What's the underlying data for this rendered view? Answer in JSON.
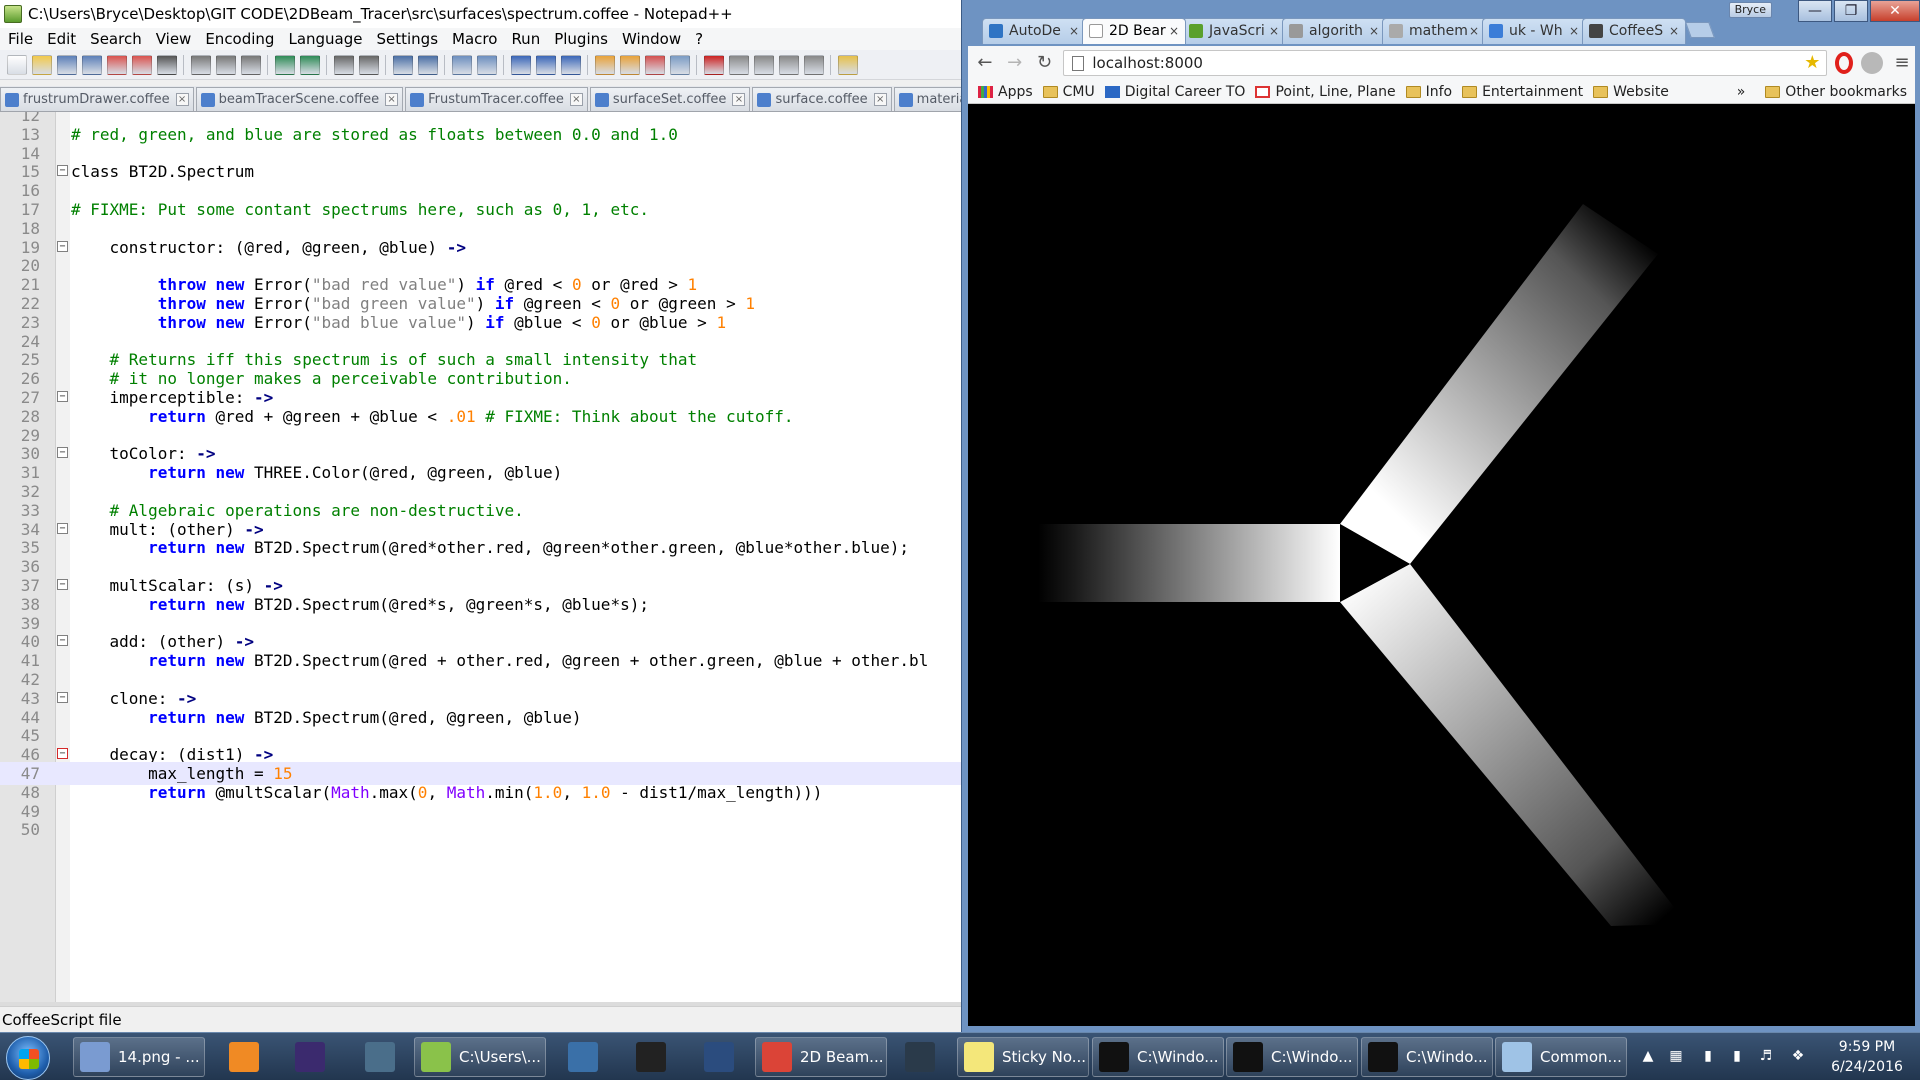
{
  "notepad": {
    "title": "C:\\Users\\Bryce\\Desktop\\GIT CODE\\2DBeam_Tracer\\src\\surfaces\\spectrum.coffee - Notepad++",
    "menu": [
      "File",
      "Edit",
      "Search",
      "View",
      "Encoding",
      "Language",
      "Settings",
      "Macro",
      "Run",
      "Plugins",
      "Window",
      "?"
    ],
    "file_tabs": [
      "frustrumDrawer.coffee",
      "beamTracerScene.coffee",
      "FrustumTracer.coffee",
      "surfaceSet.coffee",
      "surface.coffee",
      "material.coffee"
    ],
    "status": "CoffeeScript file",
    "highlighted_line": 47,
    "colors": {
      "comment": "#008000",
      "keyword": "#0000ff",
      "string": "#808080",
      "number": "#ff8000",
      "builtin": "#8000ff",
      "line_highlight": "#e8e8ff"
    },
    "lines": [
      {
        "n": "12",
        "segs": []
      },
      {
        "n": "13",
        "segs": [
          {
            "c": "cm",
            "t": "# red, green, and blue are stored as floats between 0.0 and 1.0"
          }
        ]
      },
      {
        "n": "14",
        "segs": []
      },
      {
        "n": "15",
        "fold": "minus",
        "segs": [
          {
            "c": "",
            "t": "class BT2D.Spectrum"
          }
        ]
      },
      {
        "n": "16",
        "segs": []
      },
      {
        "n": "17",
        "segs": [
          {
            "c": "cm",
            "t": "# FIXME: Put some contant spectrums here, such as 0, 1, etc."
          }
        ]
      },
      {
        "n": "18",
        "segs": []
      },
      {
        "n": "19",
        "fold": "minus",
        "segs": [
          {
            "c": "",
            "t": "    constructor: (@red, @green, @blue) "
          },
          {
            "c": "op",
            "t": "->"
          }
        ]
      },
      {
        "n": "20",
        "segs": []
      },
      {
        "n": "21",
        "segs": [
          {
            "c": "",
            "t": "         "
          },
          {
            "c": "kw",
            "t": "throw new"
          },
          {
            "c": "",
            "t": " Error("
          },
          {
            "c": "st",
            "t": "\"bad red value\""
          },
          {
            "c": "",
            "t": ") "
          },
          {
            "c": "kw",
            "t": "if"
          },
          {
            "c": "",
            "t": " @red < "
          },
          {
            "c": "nm",
            "t": "0"
          },
          {
            "c": "",
            "t": " or @red > "
          },
          {
            "c": "nm",
            "t": "1"
          }
        ]
      },
      {
        "n": "22",
        "segs": [
          {
            "c": "",
            "t": "         "
          },
          {
            "c": "kw",
            "t": "throw new"
          },
          {
            "c": "",
            "t": " Error("
          },
          {
            "c": "st",
            "t": "\"bad green value\""
          },
          {
            "c": "",
            "t": ") "
          },
          {
            "c": "kw",
            "t": "if"
          },
          {
            "c": "",
            "t": " @green < "
          },
          {
            "c": "nm",
            "t": "0"
          },
          {
            "c": "",
            "t": " or @green > "
          },
          {
            "c": "nm",
            "t": "1"
          }
        ]
      },
      {
        "n": "23",
        "segs": [
          {
            "c": "",
            "t": "         "
          },
          {
            "c": "kw",
            "t": "throw new"
          },
          {
            "c": "",
            "t": " Error("
          },
          {
            "c": "st",
            "t": "\"bad blue value\""
          },
          {
            "c": "",
            "t": ") "
          },
          {
            "c": "kw",
            "t": "if"
          },
          {
            "c": "",
            "t": " @blue < "
          },
          {
            "c": "nm",
            "t": "0"
          },
          {
            "c": "",
            "t": " or @blue > "
          },
          {
            "c": "nm",
            "t": "1"
          }
        ]
      },
      {
        "n": "24",
        "segs": []
      },
      {
        "n": "25",
        "segs": [
          {
            "c": "",
            "t": "    "
          },
          {
            "c": "cm",
            "t": "# Returns iff this spectrum is of such a small intensity that"
          }
        ]
      },
      {
        "n": "26",
        "segs": [
          {
            "c": "",
            "t": "    "
          },
          {
            "c": "cm",
            "t": "# it no longer makes a perceivable contribution."
          }
        ]
      },
      {
        "n": "27",
        "fold": "minus",
        "segs": [
          {
            "c": "",
            "t": "    imperceptible: "
          },
          {
            "c": "op",
            "t": "->"
          }
        ]
      },
      {
        "n": "28",
        "segs": [
          {
            "c": "",
            "t": "        "
          },
          {
            "c": "kw",
            "t": "return"
          },
          {
            "c": "",
            "t": " @red + @green + @blue < "
          },
          {
            "c": "nm",
            "t": ".01"
          },
          {
            "c": "",
            "t": " "
          },
          {
            "c": "cm",
            "t": "# FIXME: Think about the cutoff."
          }
        ]
      },
      {
        "n": "29",
        "segs": []
      },
      {
        "n": "30",
        "fold": "minus",
        "segs": [
          {
            "c": "",
            "t": "    toColor: "
          },
          {
            "c": "op",
            "t": "->"
          }
        ]
      },
      {
        "n": "31",
        "segs": [
          {
            "c": "",
            "t": "        "
          },
          {
            "c": "kw",
            "t": "return new"
          },
          {
            "c": "",
            "t": " THREE.Color(@red, @green, @blue)"
          }
        ]
      },
      {
        "n": "32",
        "segs": []
      },
      {
        "n": "33",
        "segs": [
          {
            "c": "",
            "t": "    "
          },
          {
            "c": "cm",
            "t": "# Algebraic operations are non-destructive."
          }
        ]
      },
      {
        "n": "34",
        "fold": "minus",
        "segs": [
          {
            "c": "",
            "t": "    mult: (other) "
          },
          {
            "c": "op",
            "t": "->"
          }
        ]
      },
      {
        "n": "35",
        "segs": [
          {
            "c": "",
            "t": "        "
          },
          {
            "c": "kw",
            "t": "return new"
          },
          {
            "c": "",
            "t": " BT2D.Spectrum(@red*other.red, @green*other.green, @blue*other.blue);"
          }
        ]
      },
      {
        "n": "36",
        "segs": []
      },
      {
        "n": "37",
        "fold": "minus",
        "segs": [
          {
            "c": "",
            "t": "    multScalar: (s) "
          },
          {
            "c": "op",
            "t": "->"
          }
        ]
      },
      {
        "n": "38",
        "segs": [
          {
            "c": "",
            "t": "        "
          },
          {
            "c": "kw",
            "t": "return new"
          },
          {
            "c": "",
            "t": " BT2D.Spectrum(@red*s, @green*s, @blue*s);"
          }
        ]
      },
      {
        "n": "39",
        "segs": []
      },
      {
        "n": "40",
        "fold": "minus",
        "segs": [
          {
            "c": "",
            "t": "    add: (other) "
          },
          {
            "c": "op",
            "t": "->"
          }
        ]
      },
      {
        "n": "41",
        "segs": [
          {
            "c": "",
            "t": "        "
          },
          {
            "c": "kw",
            "t": "return new"
          },
          {
            "c": "",
            "t": " BT2D.Spectrum(@red + other.red, @green + other.green, @blue + other.bl"
          }
        ]
      },
      {
        "n": "42",
        "segs": []
      },
      {
        "n": "43",
        "fold": "minus",
        "segs": [
          {
            "c": "",
            "t": "    clone: "
          },
          {
            "c": "op",
            "t": "->"
          }
        ]
      },
      {
        "n": "44",
        "segs": [
          {
            "c": "",
            "t": "        "
          },
          {
            "c": "kw",
            "t": "return new"
          },
          {
            "c": "",
            "t": " BT2D.Spectrum(@red, @green, @blue)"
          }
        ]
      },
      {
        "n": "45",
        "segs": []
      },
      {
        "n": "46",
        "fold": "minus-red",
        "segs": [
          {
            "c": "",
            "t": "    decay: (dist1) "
          },
          {
            "c": "op",
            "t": "->"
          }
        ]
      },
      {
        "n": "47",
        "segs": [
          {
            "c": "",
            "t": "        max_length = "
          },
          {
            "c": "nm",
            "t": "15"
          }
        ]
      },
      {
        "n": "48",
        "segs": [
          {
            "c": "",
            "t": "        "
          },
          {
            "c": "kw",
            "t": "return"
          },
          {
            "c": "",
            "t": " @multScalar("
          },
          {
            "c": "bi",
            "t": "Math"
          },
          {
            "c": "",
            "t": ".max("
          },
          {
            "c": "nm",
            "t": "0"
          },
          {
            "c": "",
            "t": ", "
          },
          {
            "c": "bi",
            "t": "Math"
          },
          {
            "c": "",
            "t": ".min("
          },
          {
            "c": "nm",
            "t": "1.0"
          },
          {
            "c": "",
            "t": ", "
          },
          {
            "c": "nm",
            "t": "1.0"
          },
          {
            "c": "",
            "t": " - dist1/max_length)))"
          }
        ]
      },
      {
        "n": "49",
        "segs": []
      },
      {
        "n": "50",
        "segs": []
      }
    ]
  },
  "chrome": {
    "user": "Bryce",
    "tabs": [
      {
        "label": "AutoDe",
        "icon": "autodesk-icon",
        "color": "#2f74c4"
      },
      {
        "label": "2D Bear",
        "icon": "page-icon",
        "color": "#ffffff",
        "active": true
      },
      {
        "label": "JavaScri",
        "icon": "javascript-icon",
        "color": "#5aa02c"
      },
      {
        "label": "algorith",
        "icon": "code-icon",
        "color": "#999999"
      },
      {
        "label": "mathem",
        "icon": "math-icon",
        "color": "#aaaaaa"
      },
      {
        "label": "uk - Wh",
        "icon": "stackexchange-icon",
        "color": "#3b7dd8"
      },
      {
        "label": "CoffeeS",
        "icon": "coffee-icon",
        "color": "#444444"
      }
    ],
    "url": "localhost:8000",
    "bookmarks": [
      {
        "label": "Apps",
        "icon": "apps-grid-icon"
      },
      {
        "label": "CMU",
        "icon": "folder-icon"
      },
      {
        "label": "Digital Career TO",
        "icon": "trello-icon"
      },
      {
        "label": "Point, Line, Plane",
        "icon": "page-icon"
      },
      {
        "label": "Info",
        "icon": "folder-icon"
      },
      {
        "label": "Entertainment",
        "icon": "folder-icon"
      },
      {
        "label": "Website",
        "icon": "folder-icon"
      }
    ],
    "overflow_label": "»",
    "other_bookmarks": "Other bookmarks"
  },
  "taskbar": {
    "items": [
      {
        "label": "14.png - ...",
        "icon": "paint-icon",
        "color": "#7a9bd1",
        "wide": true
      },
      {
        "label": "",
        "icon": "media-player-icon",
        "color": "#f08a24",
        "wide": false
      },
      {
        "label": "",
        "icon": "eclipse-icon",
        "color": "#3b2a6e",
        "wide": false
      },
      {
        "label": "",
        "icon": "sublime-icon",
        "color": "#4a6e8a",
        "wide": false
      },
      {
        "label": "C:\\Users\\...",
        "icon": "notepadpp-icon",
        "color": "#8ac24a",
        "wide": true
      },
      {
        "label": "",
        "icon": "python-icon",
        "color": "#3a70a8",
        "wide": false
      },
      {
        "label": "",
        "icon": "github-icon",
        "color": "#222222",
        "wide": false
      },
      {
        "label": "",
        "icon": "typora-icon",
        "color": "#2b4c7e",
        "wide": false
      },
      {
        "label": "2D Beam...",
        "icon": "chrome-icon",
        "color": "#db4437",
        "wide": true
      },
      {
        "label": "",
        "icon": "lightroom-icon",
        "color": "#2a3a4a",
        "wide": false
      },
      {
        "label": "Sticky No...",
        "icon": "sticky-notes-icon",
        "color": "#f4e77a",
        "wide": true
      },
      {
        "label": "C:\\Windo...",
        "icon": "cmd-icon",
        "color": "#111111",
        "wide": true
      },
      {
        "label": "C:\\Windo...",
        "icon": "cmd-icon",
        "color": "#111111",
        "wide": true
      },
      {
        "label": "C:\\Windo...",
        "icon": "cmd-icon",
        "color": "#111111",
        "wide": true
      },
      {
        "label": "Common...",
        "icon": "notes-icon",
        "color": "#9fc3e6",
        "wide": true
      }
    ],
    "time": "9:59 PM",
    "date": "6/24/2016"
  }
}
